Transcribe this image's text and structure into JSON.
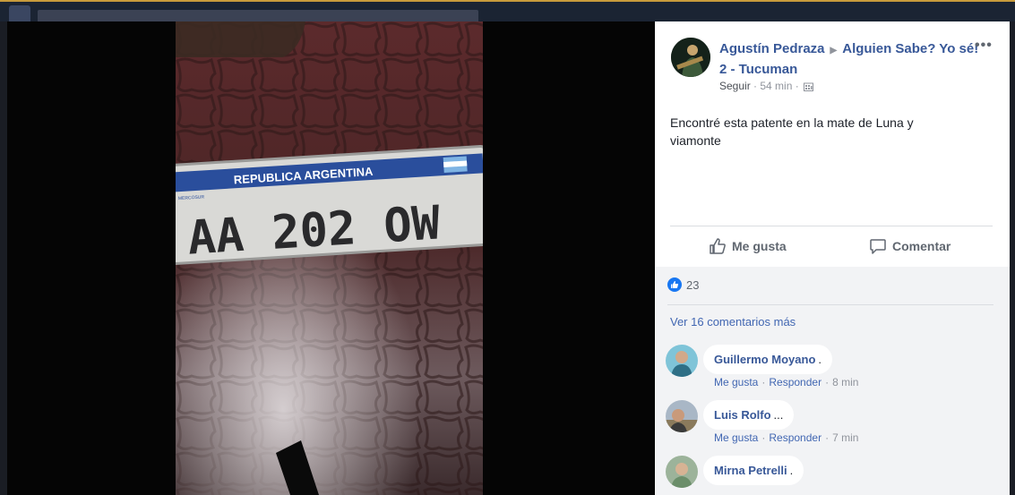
{
  "post": {
    "author": "Agustín Pedraza",
    "group": "Alguien Sabe? Yo sé! 2 - Tucuman",
    "more": "•••",
    "follow": "Seguir",
    "separator": "·",
    "time": "54 min",
    "text": "Encontré esta patente en la mate de Luna y viamonte"
  },
  "photo": {
    "plate_header": "REPUBLICA ARGENTINA",
    "plate_small": "MERCOSUR",
    "plate_number": "AA 202 OW"
  },
  "actions": {
    "like": "Me gusta",
    "comment": "Comentar"
  },
  "reactions": {
    "count": "23"
  },
  "more_comments": "Ver 16 comentarios más",
  "comments": [
    {
      "name": "Guillermo Moyano",
      "tail": ".",
      "like": "Me gusta",
      "reply": "Responder",
      "time": "8 min"
    },
    {
      "name": "Luis Rolfo",
      "tail": "...",
      "like": "Me gusta",
      "reply": "Responder",
      "time": "7 min"
    },
    {
      "name": "Mirna Petrelli",
      "tail": "."
    }
  ],
  "icons": {
    "more": "more-options-icon",
    "globe": "public-globe-icon",
    "like": "thumbs-up-icon",
    "comment": "comment-bubble-icon",
    "reaction": "like-reaction-icon"
  },
  "colors": {
    "link": "#385898",
    "accent": "#1877f2",
    "muted": "#90949c"
  }
}
